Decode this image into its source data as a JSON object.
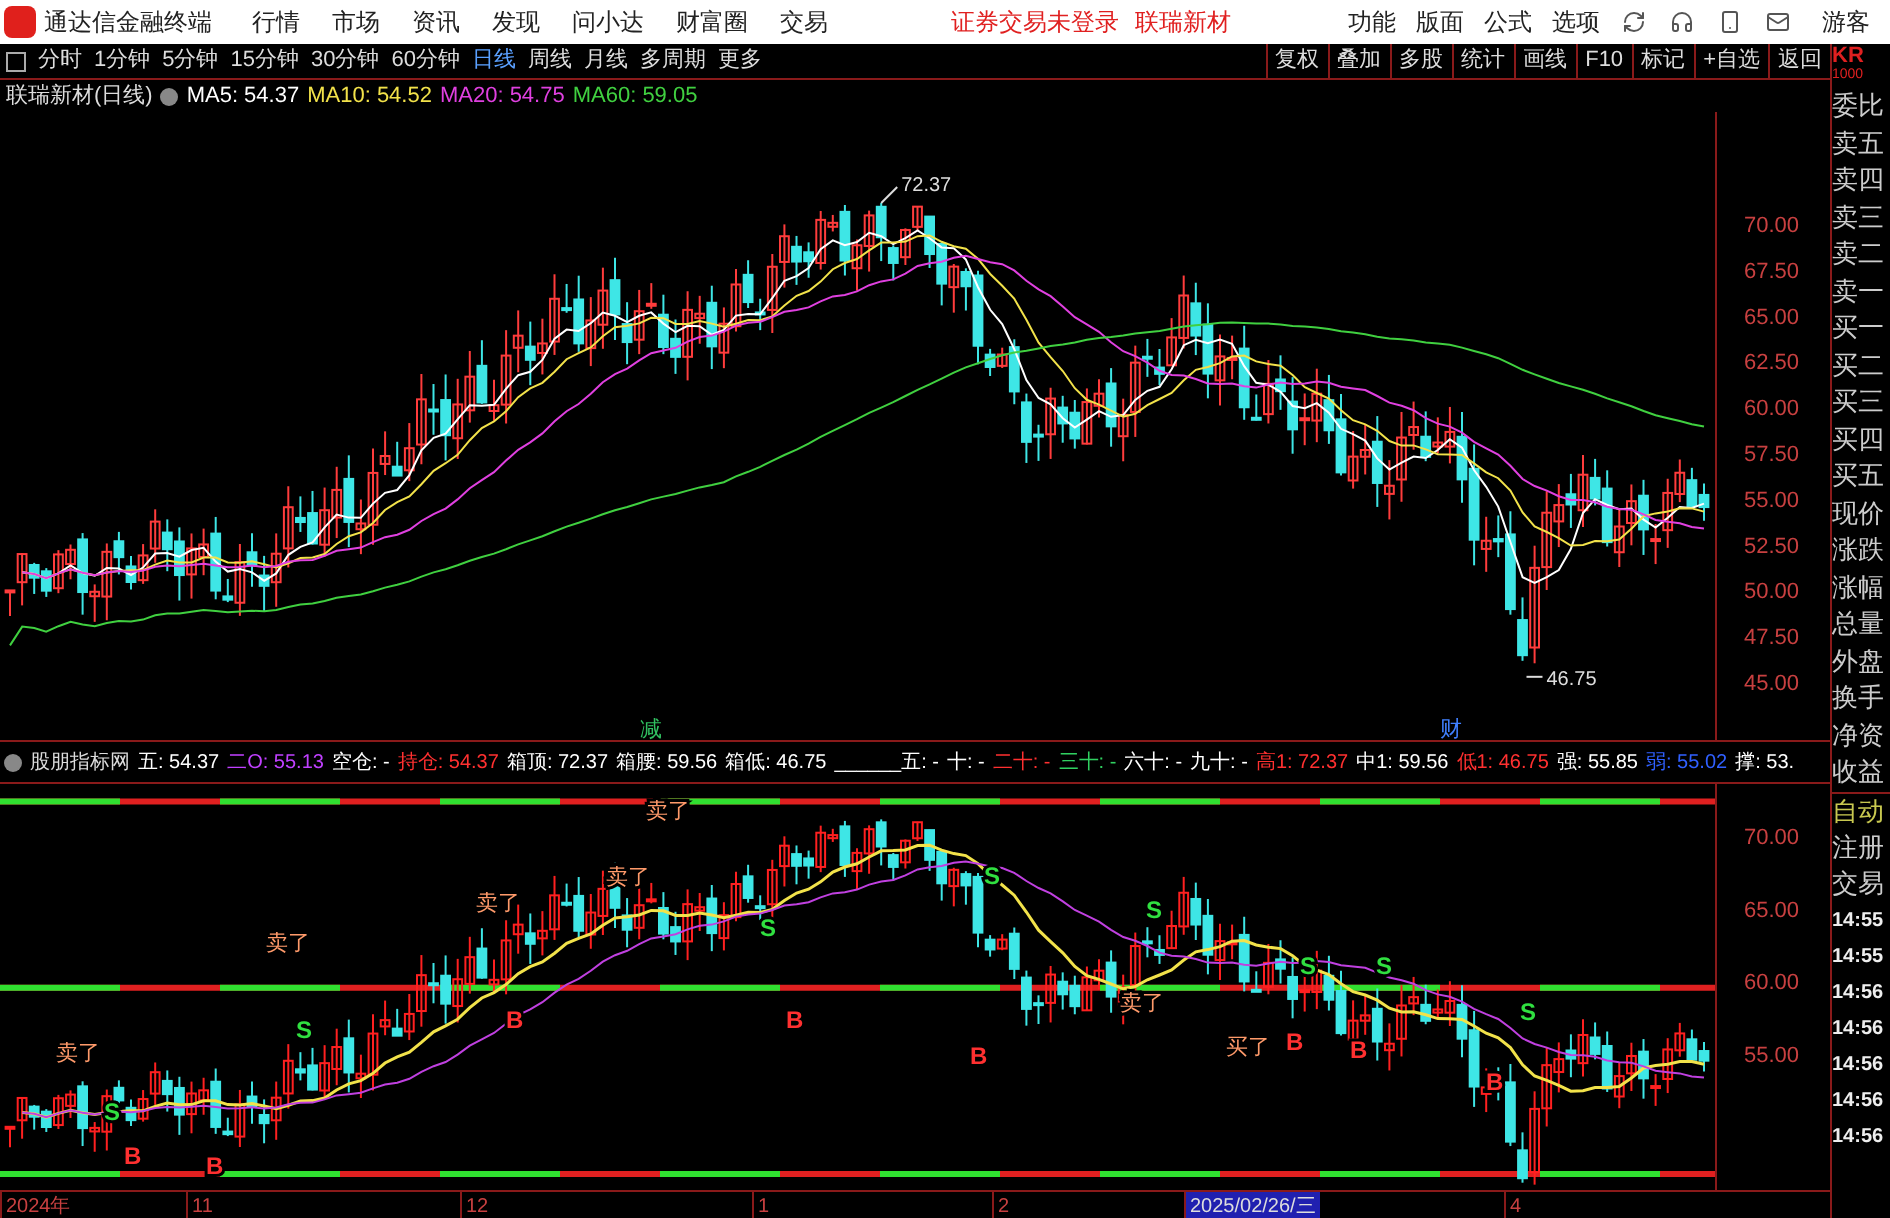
{
  "menubar": {
    "app_title": "通达信金融终端",
    "menus": [
      "行情",
      "市场",
      "资讯",
      "发现",
      "问小达",
      "财富圈",
      "交易"
    ],
    "notices": [
      "证券交易未登录",
      "联瑞新材"
    ],
    "tools": [
      "功能",
      "版面",
      "公式",
      "选项"
    ],
    "user": "游客"
  },
  "toolbar": {
    "periods": [
      {
        "label": "分时",
        "selected": false
      },
      {
        "label": "1分钟",
        "selected": false
      },
      {
        "label": "5分钟",
        "selected": false
      },
      {
        "label": "15分钟",
        "selected": false
      },
      {
        "label": "30分钟",
        "selected": false
      },
      {
        "label": "60分钟",
        "selected": false
      },
      {
        "label": "日线",
        "selected": true
      },
      {
        "label": "周线",
        "selected": false
      },
      {
        "label": "月线",
        "selected": false
      },
      {
        "label": "多周期",
        "selected": false
      },
      {
        "label": "更多",
        "selected": false
      }
    ],
    "buttons": [
      "复权",
      "叠加",
      "多股",
      "统计",
      "画线",
      "F10",
      "标记",
      "+自选",
      "返回"
    ]
  },
  "main_chart": {
    "title": "联瑞新材(日线)",
    "legend": [
      {
        "text": "MA5: 54.37",
        "color": "#ffffff"
      },
      {
        "text": "MA10: 54.52",
        "color": "#f2e24a"
      },
      {
        "text": "MA20: 54.75",
        "color": "#e040e0"
      },
      {
        "text": "MA60: 59.05",
        "color": "#40d040"
      }
    ],
    "price_ticks": [
      "70.00",
      "67.50",
      "65.00",
      "62.50",
      "60.00",
      "57.50",
      "55.00",
      "52.50",
      "50.00",
      "47.50",
      "45.00"
    ],
    "high_label": "72.37",
    "low_label": "46.75",
    "markers": [
      {
        "text": "减",
        "color": "#30c060"
      },
      {
        "text": "财",
        "color": "#4080ff"
      }
    ]
  },
  "indicator": {
    "name": "股朋指标网",
    "values": [
      {
        "text": "五: 54.37",
        "color": "#ffffff"
      },
      {
        "text": "二O: 55.13",
        "color": "#c040ff"
      },
      {
        "text": "空仓: -",
        "color": "#ffffff"
      },
      {
        "text": "持仓: 54.37",
        "color": "#ff3030"
      },
      {
        "text": "箱顶: 72.37",
        "color": "#ffffff"
      },
      {
        "text": "箱腰: 59.56",
        "color": "#ffffff"
      },
      {
        "text": "箱低: 46.75",
        "color": "#ffffff"
      },
      {
        "text": "______五: -",
        "color": "#ffffff"
      },
      {
        "text": "十: -",
        "color": "#ffffff"
      },
      {
        "text": "二十: -",
        "color": "#ff3030"
      },
      {
        "text": "三十: -",
        "color": "#30d060"
      },
      {
        "text": "六十: -",
        "color": "#ffffff"
      },
      {
        "text": "九十: -",
        "color": "#ffffff"
      },
      {
        "text": "高1: 72.37",
        "color": "#ff3030"
      },
      {
        "text": "中1: 59.56",
        "color": "#ffffff"
      },
      {
        "text": "低1: 46.75",
        "color": "#ff3030"
      },
      {
        "text": "强: 55.85",
        "color": "#ffffff"
      },
      {
        "text": "弱: 55.02",
        "color": "#3060ff"
      },
      {
        "text": "撑: 53.",
        "color": "#ffffff"
      }
    ],
    "price_ticks": [
      "70.00",
      "65.00",
      "60.00",
      "55.00"
    ],
    "signals": [
      {
        "text": "卖了",
        "kind": "sell"
      },
      {
        "text": "卖了",
        "kind": "sell"
      },
      {
        "text": "卖了",
        "kind": "sell"
      },
      {
        "text": "卖了",
        "kind": "sell"
      },
      {
        "text": "卖了",
        "kind": "sell"
      },
      {
        "text": "卖了",
        "kind": "sell"
      },
      {
        "text": "买了",
        "kind": "buy"
      },
      {
        "text": "S",
        "kind": "s"
      },
      {
        "text": "S",
        "kind": "s"
      },
      {
        "text": "S",
        "kind": "s"
      },
      {
        "text": "S",
        "kind": "s"
      },
      {
        "text": "S",
        "kind": "s"
      },
      {
        "text": "S",
        "kind": "s"
      },
      {
        "text": "S",
        "kind": "s"
      },
      {
        "text": "S",
        "kind": "s"
      },
      {
        "text": "B",
        "kind": "b"
      },
      {
        "text": "B",
        "kind": "b"
      },
      {
        "text": "B",
        "kind": "b"
      },
      {
        "text": "B",
        "kind": "b"
      },
      {
        "text": "B",
        "kind": "b"
      },
      {
        "text": "B",
        "kind": "b"
      },
      {
        "text": "B",
        "kind": "b"
      },
      {
        "text": "B",
        "kind": "b"
      }
    ]
  },
  "date_axis": [
    {
      "text": "2024年",
      "selected": false
    },
    {
      "text": "11",
      "selected": false
    },
    {
      "text": "12",
      "selected": false
    },
    {
      "text": "1",
      "selected": false
    },
    {
      "text": "2",
      "selected": false
    },
    {
      "text": "2025/02/26/三",
      "selected": true
    },
    {
      "text": "4",
      "selected": false
    }
  ],
  "quote_panel": {
    "code": "KR",
    "code_sub": "1000",
    "rows": [
      {
        "text": "委比",
        "kind": "label"
      },
      {
        "text": "卖五",
        "kind": "label"
      },
      {
        "text": "卖四",
        "kind": "label"
      },
      {
        "text": "卖三",
        "kind": "label"
      },
      {
        "text": "卖二",
        "kind": "label"
      },
      {
        "text": "卖一",
        "kind": "label"
      },
      {
        "text": "买一",
        "kind": "label"
      },
      {
        "text": "买二",
        "kind": "label"
      },
      {
        "text": "买三",
        "kind": "label"
      },
      {
        "text": "买四",
        "kind": "label"
      },
      {
        "text": "买五",
        "kind": "label"
      },
      {
        "text": "现价",
        "kind": "label"
      },
      {
        "text": "涨跌",
        "kind": "label"
      },
      {
        "text": "涨幅",
        "kind": "label"
      },
      {
        "text": "总量",
        "kind": "label"
      },
      {
        "text": "外盘",
        "kind": "label"
      },
      {
        "text": "换手",
        "kind": "label"
      },
      {
        "text": "净资",
        "kind": "label"
      },
      {
        "text": "收益",
        "kind": "label"
      },
      {
        "text": "自动",
        "kind": "tab"
      },
      {
        "text": "注册",
        "kind": "label"
      },
      {
        "text": "交易",
        "kind": "label"
      },
      {
        "text": "14:55",
        "kind": "time"
      },
      {
        "text": "14:55",
        "kind": "time"
      },
      {
        "text": "14:56",
        "kind": "time"
      },
      {
        "text": "14:56",
        "kind": "time"
      },
      {
        "text": "14:56",
        "kind": "time"
      },
      {
        "text": "14:56",
        "kind": "time"
      },
      {
        "text": "14:56",
        "kind": "time"
      }
    ]
  }
}
